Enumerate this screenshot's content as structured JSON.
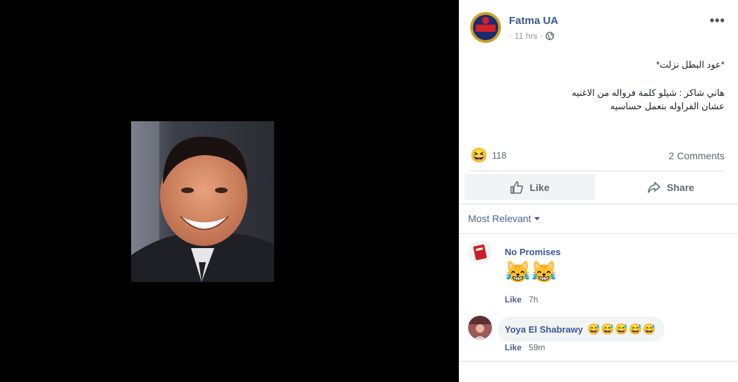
{
  "post": {
    "author": "Fatma UA",
    "time": "11 hrs",
    "separator": "·",
    "text_line1": "*عود البطل نزلت*",
    "text_line2": "هاني شاكر : شيلو كلمة فرواله من الاغنيه",
    "text_line3": "عشان الفراوله بتعمل حساسيه",
    "reaction_icon": "😆",
    "reaction_count": "118",
    "comments_count": "2 Comments",
    "more_icon": "•••"
  },
  "actions": {
    "like_label": "Like",
    "share_label": "Share"
  },
  "comments_section": {
    "sort_label": "Most Relevant",
    "comments": [
      {
        "name": "No Promises",
        "text": "😹😹",
        "like": "Like",
        "time": "7h"
      },
      {
        "name": "Yoya El Shabrawy",
        "text": "😅😅😅😅😅",
        "like": "Like",
        "time": "59m"
      }
    ]
  },
  "colors": {
    "link": "#385898",
    "muted": "#90949c",
    "divider": "#dadde1"
  }
}
